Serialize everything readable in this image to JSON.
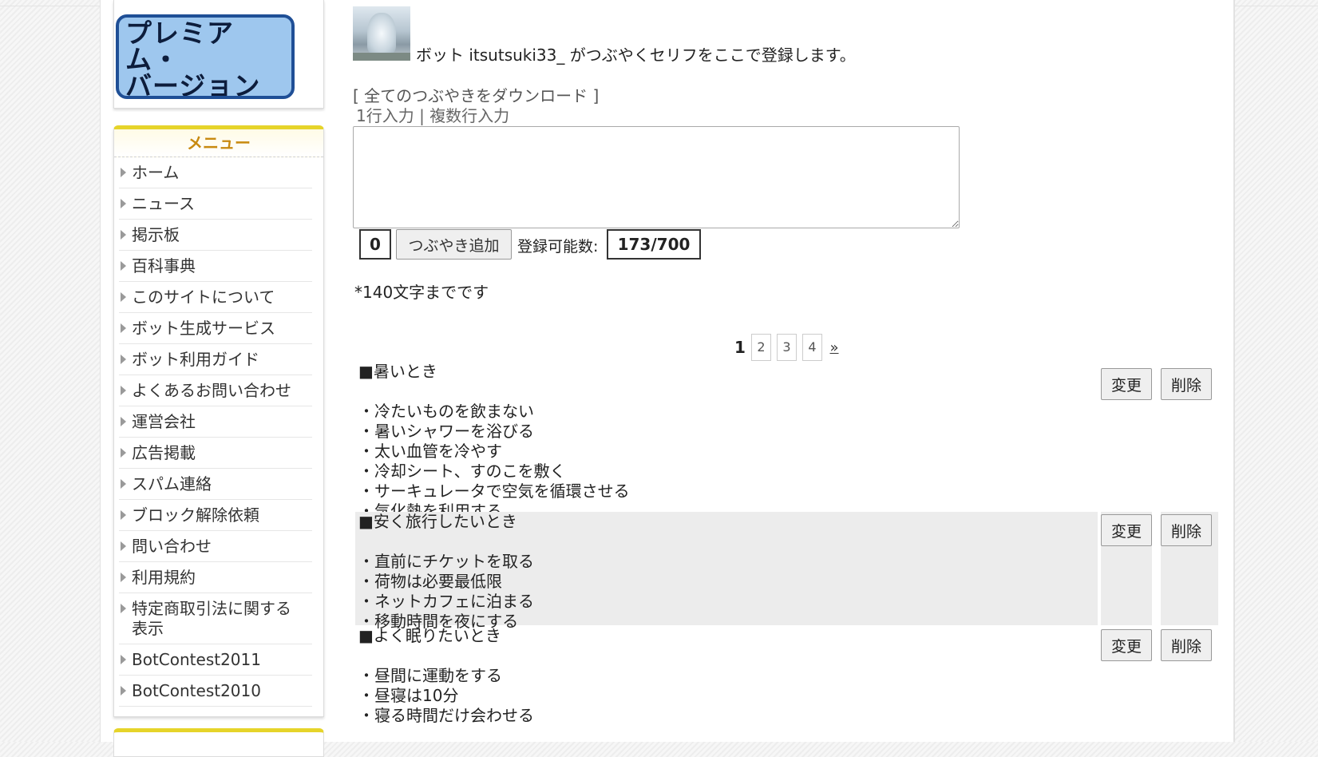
{
  "sidebar": {
    "premium_banner": "プレミアム・\nバージョンは\nこちら",
    "menu_title": "メニュー",
    "menu_items": [
      "ホーム",
      "ニュース",
      "掲示板",
      "百科事典",
      "このサイトについて",
      "ボット生成サービス",
      "ボット利用ガイド",
      "よくあるお問い合わせ",
      "運営会社",
      "広告掲載",
      "スパム連絡",
      "ブロック解除依頼",
      "問い合わせ",
      "利用規約",
      "特定商取引法に関する\n表示",
      "BotContest2011",
      "BotContest2010"
    ]
  },
  "main": {
    "intro": "ボット itsutsuki33_ がつぶやくセリフをここで登録します。",
    "download_link": "[ 全てのつぶやきをダウンロード ]",
    "single_line_input": "1行入力",
    "mode_separator": " | ",
    "multi_line_input": "複数行入力",
    "textarea_value": "",
    "char_count": "0",
    "add_button": "つぶやき追加",
    "capacity_label": "登録可能数:",
    "capacity_value": "173/700",
    "limit_note": "*140文字までです",
    "pagination": {
      "current": "1",
      "pages": [
        "2",
        "3",
        "4"
      ],
      "next": "»"
    },
    "edit_label": "変更",
    "delete_label": "削除",
    "entries": [
      {
        "text": "■暑いとき\n\n・冷たいものを飲まない\n・暑いシャワーを浴びる\n・太い血管を冷やす\n・冷却シート、すのこを敷く\n・サーキュレータで空気を循環させる\n・気化熱を利用する"
      },
      {
        "text": "■安く旅行したいとき\n\n・直前にチケットを取る\n・荷物は必要最低限\n・ネットカフェに泊まる\n・移動時間を夜にする"
      },
      {
        "text": "■よく眠りたいとき\n\n・昼間に運動をする\n・昼寝は10分\n・寝る時間だけ会わせる"
      }
    ]
  },
  "colors": {
    "menu_accent": "#e6d42a",
    "menu_title": "#c88a10",
    "premium_banner_bg": "#9ec7ee",
    "premium_banner_border": "#1f4f96",
    "shaded_row": "#ececec"
  }
}
